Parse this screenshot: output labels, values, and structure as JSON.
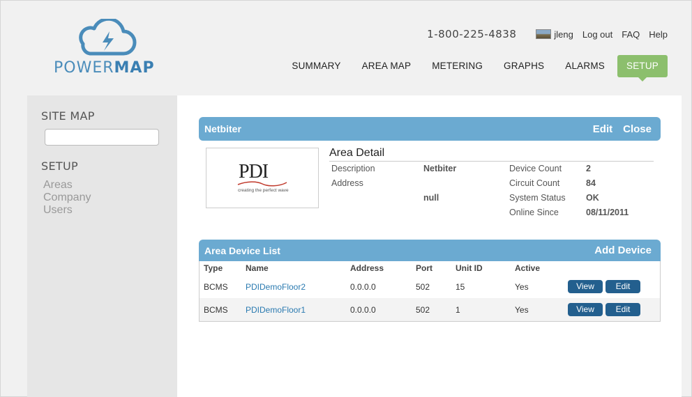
{
  "brand": {
    "name_part1": "POWER",
    "name_part2": "MAP"
  },
  "topbar": {
    "phone": "1-800-225-4838",
    "user": "jleng",
    "links": [
      "Log out",
      "FAQ",
      "Help"
    ]
  },
  "nav": {
    "items": [
      "SUMMARY",
      "AREA MAP",
      "METERING",
      "GRAPHS",
      "ALARMS",
      "SETUP"
    ],
    "active": "SETUP"
  },
  "sidebar": {
    "site_map": "SITE MAP",
    "setup": "SETUP",
    "links": [
      "Areas",
      "Company",
      "Users"
    ]
  },
  "area_header": {
    "title": "Netbiter",
    "edit": "Edit",
    "close": "Close"
  },
  "logo_image": {
    "text": "PDI",
    "tagline": "creating the perfect wave"
  },
  "area_detail": {
    "title": "Area Detail",
    "description_label": "Description",
    "description_value": "Netbiter",
    "address_label": "Address",
    "address_value": "null",
    "device_count_label": "Device Count",
    "device_count_value": "2",
    "circuit_count_label": "Circuit Count",
    "circuit_count_value": "84",
    "system_status_label": "System Status",
    "system_status_value": "OK",
    "online_since_label": "Online Since",
    "online_since_value": "08/11/2011"
  },
  "device_list": {
    "title": "Area Device List",
    "add": "Add Device",
    "columns": [
      "Type",
      "Name",
      "Address",
      "Port",
      "Unit ID",
      "Active"
    ],
    "rows": [
      {
        "type": "BCMS",
        "name": "PDIDemoFloor2",
        "address": "0.0.0.0",
        "port": "502",
        "unit_id": "15",
        "active": "Yes"
      },
      {
        "type": "BCMS",
        "name": "PDIDemoFloor1",
        "address": "0.0.0.0",
        "port": "502",
        "unit_id": "1",
        "active": "Yes"
      }
    ],
    "view_label": "View",
    "edit_label": "Edit"
  },
  "colors": {
    "accent": "#6baad1",
    "nav_active": "#8cbf6d",
    "button": "#235f8e"
  }
}
